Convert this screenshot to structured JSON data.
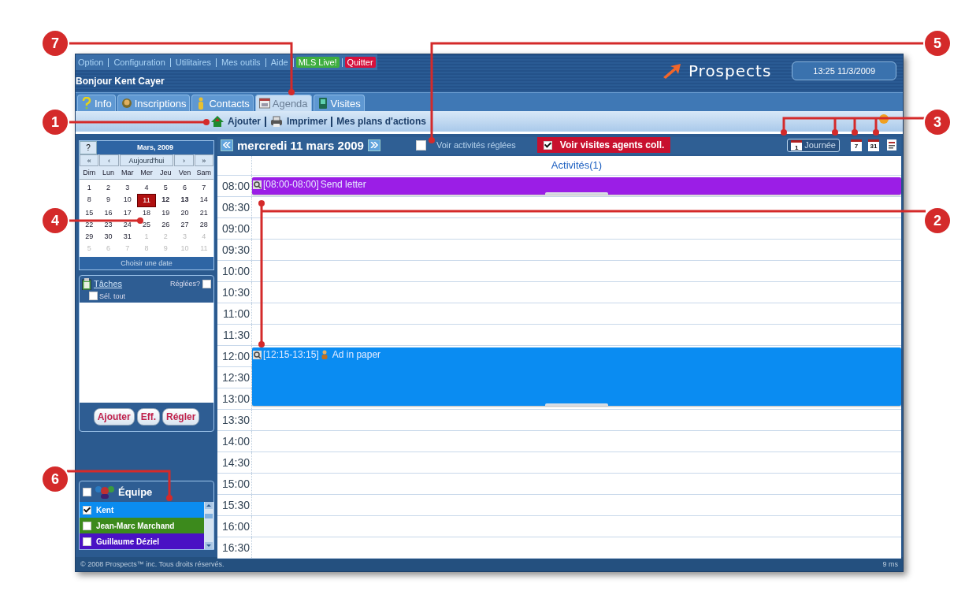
{
  "top_links": [
    {
      "label": "Option",
      "kind": "link"
    },
    {
      "label": "Configuration",
      "kind": "link"
    },
    {
      "label": "Utilitaires",
      "kind": "link"
    },
    {
      "label": "Mes outils",
      "kind": "link"
    },
    {
      "label": "Aide",
      "kind": "link"
    },
    {
      "label": "MLS Live!",
      "kind": "live"
    },
    {
      "label": "Quitter",
      "kind": "quit"
    }
  ],
  "greeting": "Bonjour Kent Cayer",
  "brand": "Prospects",
  "clock": "13:25 11/3/2009",
  "tabs": [
    {
      "label": "Info",
      "selected": false
    },
    {
      "label": "Inscriptions",
      "selected": false
    },
    {
      "label": "Contacts",
      "selected": false
    },
    {
      "label": "Agenda",
      "selected": true
    },
    {
      "label": "Visites",
      "selected": false
    }
  ],
  "actions": [
    "Ajouter",
    "Imprimer",
    "Mes plans d'actions"
  ],
  "mini_calendar": {
    "help": "?",
    "title": "Mars, 2009",
    "nav": [
      "«",
      "‹",
      "Aujourd'hui",
      "›",
      "»"
    ],
    "weekdays": [
      "Dim",
      "Lun",
      "Mar",
      "Mer",
      "Jeu",
      "Ven",
      "Sam"
    ],
    "weeks": [
      [
        {
          "d": "1",
          "other_month": false,
          "selected": false,
          "bold": false
        },
        {
          "d": "2",
          "other_month": false,
          "selected": false,
          "bold": false
        },
        {
          "d": "3",
          "other_month": false,
          "selected": false,
          "bold": false
        },
        {
          "d": "4",
          "other_month": false,
          "selected": false,
          "bold": false
        },
        {
          "d": "5",
          "other_month": false,
          "selected": false,
          "bold": false
        },
        {
          "d": "6",
          "other_month": false,
          "selected": false,
          "bold": false
        },
        {
          "d": "7",
          "other_month": false,
          "selected": false,
          "bold": false
        }
      ],
      [
        {
          "d": "8",
          "other_month": false,
          "selected": false,
          "bold": false
        },
        {
          "d": "9",
          "other_month": false,
          "selected": false,
          "bold": false
        },
        {
          "d": "10",
          "other_month": false,
          "selected": false,
          "bold": false
        },
        {
          "d": "11",
          "other_month": false,
          "selected": true,
          "bold": false
        },
        {
          "d": "12",
          "other_month": false,
          "selected": false,
          "bold": true
        },
        {
          "d": "13",
          "other_month": false,
          "selected": false,
          "bold": true
        },
        {
          "d": "14",
          "other_month": false,
          "selected": false,
          "bold": false
        }
      ],
      [
        {
          "d": "15",
          "other_month": false,
          "selected": false,
          "bold": false
        },
        {
          "d": "16",
          "other_month": false,
          "selected": false,
          "bold": false
        },
        {
          "d": "17",
          "other_month": false,
          "selected": false,
          "bold": false
        },
        {
          "d": "18",
          "other_month": false,
          "selected": false,
          "bold": false
        },
        {
          "d": "19",
          "other_month": false,
          "selected": false,
          "bold": false
        },
        {
          "d": "20",
          "other_month": false,
          "selected": false,
          "bold": false
        },
        {
          "d": "21",
          "other_month": false,
          "selected": false,
          "bold": false
        }
      ],
      [
        {
          "d": "22",
          "other_month": false,
          "selected": false,
          "bold": false
        },
        {
          "d": "23",
          "other_month": false,
          "selected": false,
          "bold": false
        },
        {
          "d": "24",
          "other_month": false,
          "selected": false,
          "bold": false
        },
        {
          "d": "25",
          "other_month": false,
          "selected": false,
          "bold": false
        },
        {
          "d": "26",
          "other_month": false,
          "selected": false,
          "bold": false
        },
        {
          "d": "27",
          "other_month": false,
          "selected": false,
          "bold": false
        },
        {
          "d": "28",
          "other_month": false,
          "selected": false,
          "bold": false
        }
      ],
      [
        {
          "d": "29",
          "other_month": false,
          "selected": false,
          "bold": false
        },
        {
          "d": "30",
          "other_month": false,
          "selected": false,
          "bold": false
        },
        {
          "d": "31",
          "other_month": false,
          "selected": false,
          "bold": false
        },
        {
          "d": "1",
          "other_month": true,
          "selected": false,
          "bold": false
        },
        {
          "d": "2",
          "other_month": true,
          "selected": false,
          "bold": false
        },
        {
          "d": "3",
          "other_month": true,
          "selected": false,
          "bold": false
        },
        {
          "d": "4",
          "other_month": true,
          "selected": false,
          "bold": false
        }
      ],
      [
        {
          "d": "5",
          "other_month": true,
          "selected": false,
          "bold": false
        },
        {
          "d": "6",
          "other_month": true,
          "selected": false,
          "bold": false
        },
        {
          "d": "7",
          "other_month": true,
          "selected": false,
          "bold": false
        },
        {
          "d": "8",
          "other_month": true,
          "selected": false,
          "bold": false
        },
        {
          "d": "9",
          "other_month": true,
          "selected": false,
          "bold": false
        },
        {
          "d": "10",
          "other_month": true,
          "selected": false,
          "bold": false
        },
        {
          "d": "11",
          "other_month": true,
          "selected": false,
          "bold": false
        }
      ]
    ],
    "choose": "Choisir une date"
  },
  "tasks": {
    "title": "Tâches",
    "settled_label": "Réglées?",
    "settled_checked": false,
    "select_all": "Sél. tout",
    "select_all_checked": false,
    "buttons": [
      "Ajouter",
      "Eff.",
      "Régler"
    ]
  },
  "team": {
    "title": "Équipe",
    "checked": false,
    "members": [
      {
        "name": "Kent",
        "checked": true,
        "color": "#0b8cf0"
      },
      {
        "name": "Jean-Marc Marchand",
        "checked": false,
        "color": "#3c8a1c"
      },
      {
        "name": "Guillaume Déziel",
        "checked": false,
        "color": "#4a12c4"
      }
    ]
  },
  "day_view": {
    "date": "mercredi 11 mars 2009",
    "show_settled": {
      "label": "Voir activités réglées",
      "checked": false
    },
    "show_agents": {
      "label": "Voir visites agents coll.",
      "checked": true
    },
    "views": [
      {
        "label": "Journée",
        "icon_text": "1",
        "selected": true
      },
      {
        "icon_text": "7",
        "selected": false
      },
      {
        "icon_text": "31",
        "selected": false
      },
      {
        "selected": false
      }
    ],
    "column_title": "Activités(1)",
    "slots": [
      {
        "time": "08:00",
        "event": {
          "time": "[08:00-08:00]",
          "title": "Send letter",
          "color": "#9b1ee6",
          "contact": false
        }
      },
      {
        "time": "08:30"
      },
      {
        "time": "09:00"
      },
      {
        "time": "09:30"
      },
      {
        "time": "10:00"
      },
      {
        "time": "10:30"
      },
      {
        "time": "11:00"
      },
      {
        "time": "11:30"
      },
      {
        "time": "12:00",
        "event": {
          "time": "[12:15-13:15]",
          "title": "Ad in paper",
          "color": "#0a8cf2",
          "contact": true
        }
      },
      {
        "time": "12:30",
        "continues": true
      },
      {
        "time": "13:00",
        "continues": true
      },
      {
        "time": "13:30"
      },
      {
        "time": "14:00"
      },
      {
        "time": "14:30"
      },
      {
        "time": "15:00"
      },
      {
        "time": "15:30"
      },
      {
        "time": "16:00"
      },
      {
        "time": "16:30"
      }
    ]
  },
  "footer": {
    "copyright": "© 2008 Prospects™ inc. Tous droits réservés.",
    "timing": "9 ms"
  },
  "callouts": [
    "7",
    "5",
    "1",
    "3",
    "4",
    "2",
    "6"
  ]
}
